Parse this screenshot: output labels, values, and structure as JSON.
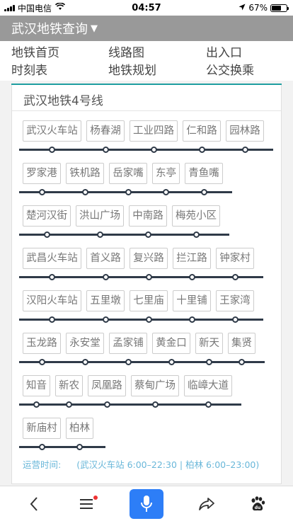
{
  "status_bar": {
    "carrier": "中国电信",
    "time": "04:57",
    "battery_percent": "67%",
    "battery_level": 0.67
  },
  "header": {
    "title": "武汉地铁查询"
  },
  "nav": [
    "地铁首页",
    "线路图",
    "出入口",
    "时刻表",
    "地铁规划",
    "公交换乘"
  ],
  "line": {
    "title": "武汉地铁4号线",
    "rows": [
      [
        "武汉火车站",
        "杨春湖",
        "工业四路",
        "仁和路",
        "园林路"
      ],
      [
        "罗家港",
        "铁机路",
        "岳家嘴",
        "东亭",
        "青鱼嘴"
      ],
      [
        "楚河汉街",
        "洪山广场",
        "中南路",
        "梅苑小区"
      ],
      [
        "武昌火车站",
        "首义路",
        "复兴路",
        "拦江路",
        "钟家村"
      ],
      [
        "汉阳火车站",
        "五里墩",
        "七里庙",
        "十里铺",
        "王家湾"
      ],
      [
        "玉龙路",
        "永安堂",
        "孟家铺",
        "黄金口",
        "新天",
        "集贤"
      ],
      [
        "知音",
        "新农",
        "凤凰路",
        "蔡甸广场",
        "临嶂大道"
      ],
      [
        "新庙村",
        "柏林"
      ]
    ],
    "operating_label": "运营时间:",
    "operating_hours": "(武汉火车站 6:00–22:30 | 柏林 6:00–23:00)"
  },
  "bottom_bar": {
    "icons": [
      "back-icon",
      "menu-icon",
      "microphone-icon",
      "share-icon",
      "baidu-paw-icon"
    ],
    "accent_color": "#2d7ef7"
  },
  "colors": {
    "header_bg": "#999999",
    "accent_teal": "#1e9ea0",
    "track": "#2f3a48",
    "time_text": "#69b7d9"
  }
}
